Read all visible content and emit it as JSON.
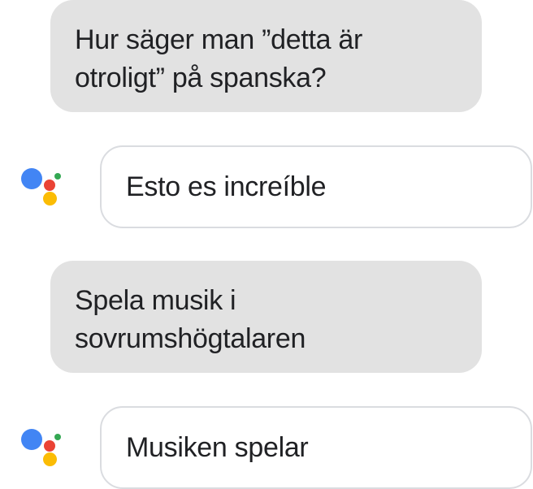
{
  "conversation": {
    "messages": [
      {
        "sender": "user",
        "text": "Hur säger man ”detta är otroligt” på spanska?"
      },
      {
        "sender": "assistant",
        "text": "Esto es increíble"
      },
      {
        "sender": "user",
        "text": "Spela musik i sovrumshögtalaren"
      },
      {
        "sender": "assistant",
        "text": "Musiken spelar"
      }
    ]
  },
  "assistant_icon": "google-assistant-icon",
  "colors": {
    "user_bubble_bg": "#e2e2e2",
    "assistant_bubble_border": "#dadce0",
    "logo_blue": "#4285f4",
    "logo_red": "#ea4335",
    "logo_yellow": "#fbbc04",
    "logo_green": "#34a853"
  }
}
